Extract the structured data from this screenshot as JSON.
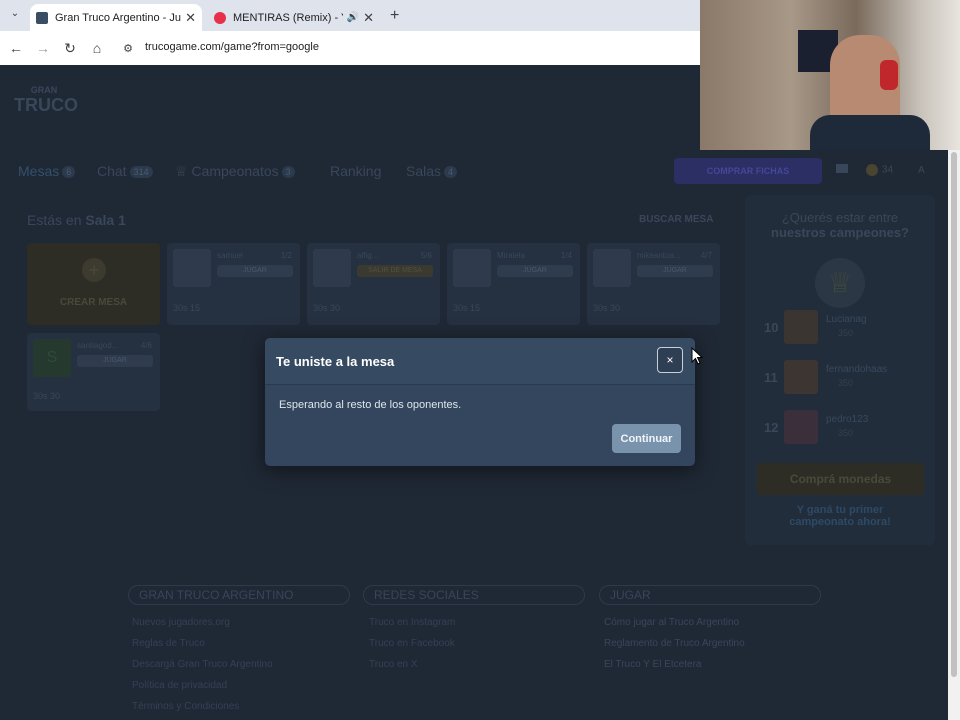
{
  "browser": {
    "tabs": [
      {
        "title": "Gran Truco Argentino - Juego C",
        "active": true,
        "favicon_color": "#3b4d63"
      },
      {
        "title": "MENTIRAS (Remix) - YouTub",
        "active": false,
        "favicon_color": "#e8304a"
      }
    ],
    "url": "trucogame.com/game?from=google"
  },
  "site": {
    "logo_top": "GRAN",
    "logo_main": "TRUCO",
    "nav": [
      {
        "label": "Mesas",
        "badge": "6"
      },
      {
        "label": "Chat",
        "badge": "314"
      },
      {
        "label": "Campeonatos",
        "badge": "3"
      },
      {
        "label": "Ranking",
        "badge": ""
      },
      {
        "label": "Salas",
        "badge": "4"
      }
    ],
    "buy_button": "COMPRAR FICHAS",
    "coins": "34",
    "location_prefix": "Estás en ",
    "location_room": "Sala 1",
    "search_table": "BUSCAR MESA",
    "create_table": "CREAR MESA",
    "tables": [
      {
        "name": "samuel",
        "count": "1/2",
        "action": "JUGAR",
        "stats": "30s 15"
      },
      {
        "name": "alfig...",
        "count": "5/6",
        "action": "SALIR DE MESA",
        "stats": "30s 30"
      },
      {
        "name": "Miralela",
        "count": "1/4",
        "action": "JUGAR",
        "stats": "30s 15"
      },
      {
        "name": "mikeantoa...",
        "count": "4/7",
        "action": "JUGAR",
        "stats": "30s 30"
      },
      {
        "name": "santiagod...",
        "count": "4/6",
        "action": "JUGAR",
        "stats": "30s 30"
      }
    ],
    "sidebar": {
      "heading_1": "¿Querés estar entre",
      "heading_2": "nuestros campeones?",
      "ranking": [
        {
          "pos": "10",
          "name": "Lucianag",
          "score": "350"
        },
        {
          "pos": "11",
          "name": "fernandohaas",
          "score": "350"
        },
        {
          "pos": "12",
          "name": "pedro123",
          "score": "350"
        }
      ],
      "buy_coins": "Comprá monedas",
      "cta_1": "Y ganá tu primer",
      "cta_2": "campeonato ahora!"
    },
    "footer": {
      "columns": [
        {
          "title": "GRAN TRUCO ARGENTINO",
          "links": [
            "Nuevos jugadores.org",
            "Reglas de Truco",
            "Descargá Gran Truco Argentino",
            "Política de privacidad",
            "Términos y Condiciones"
          ]
        },
        {
          "title": "REDES SOCIALES",
          "links": [
            "Truco en Instagram",
            "Truco en Facebook",
            "Truco en X"
          ]
        },
        {
          "title": "JUGAR",
          "links": [
            "Cómo jugar al Truco Argentino",
            "Reglamento de Truco Argentino",
            "El Truco Y El Etcetera"
          ]
        }
      ]
    }
  },
  "modal": {
    "title": "Te uniste a la mesa",
    "close_label": "×",
    "body": "Esperando al resto de los oponentes.",
    "button": "Continuar"
  },
  "colors": {
    "overlay_bg": "#1f2835",
    "modal_bg": "#33465d",
    "button_bg": "#7a93ad",
    "buy_button": "#3a3a8a",
    "create_card": "#3a3322"
  }
}
